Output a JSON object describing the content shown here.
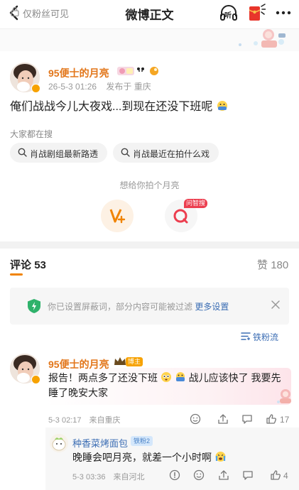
{
  "nav": {
    "title": "微博正文",
    "listen_label": "听"
  },
  "visibility": {
    "text": "仅粉丝可见"
  },
  "post": {
    "username": "95便士的月亮",
    "time": "26-5-3 01:26",
    "location": "发布于 重庆",
    "text": "俺们战战今儿大夜戏...到现在还没下班呢",
    "everyone_search_title": "大家都在搜",
    "search_chips": [
      "肖战剧组最新路透",
      "肖战最近在拍什么戏"
    ],
    "prompt": "想给你拍个月亮",
    "ask_badge": "问智搜"
  },
  "comments_header": {
    "comments_label": "评论",
    "comments_count": "53",
    "likes_label": "赞",
    "likes_count": "180"
  },
  "filter_notice": {
    "text": "你已设置屏蔽词，部分内容可能被过滤",
    "link": "更多设置"
  },
  "fan_stream": {
    "label": "铁粉流"
  },
  "comment": {
    "username": "95便士的月亮",
    "role_badge": "博主",
    "text": "报告！两点多了还没下班",
    "text2": "战儿应该快了 我要先睡了晚安大家",
    "time": "5-3 02:17",
    "from": "来自重庆",
    "likes": "17"
  },
  "reply": {
    "username": "种香菜烤面包",
    "fan_badge": "铁粉2",
    "text": "晚睡会吧月亮，就差一个小时啊",
    "time": "5-3 03:36",
    "from": "来自河北",
    "likes": "4"
  },
  "colors": {
    "accent": "#f08300",
    "username": "#e2761a",
    "link": "#3c6eb4",
    "shield": "#2fb26b"
  }
}
